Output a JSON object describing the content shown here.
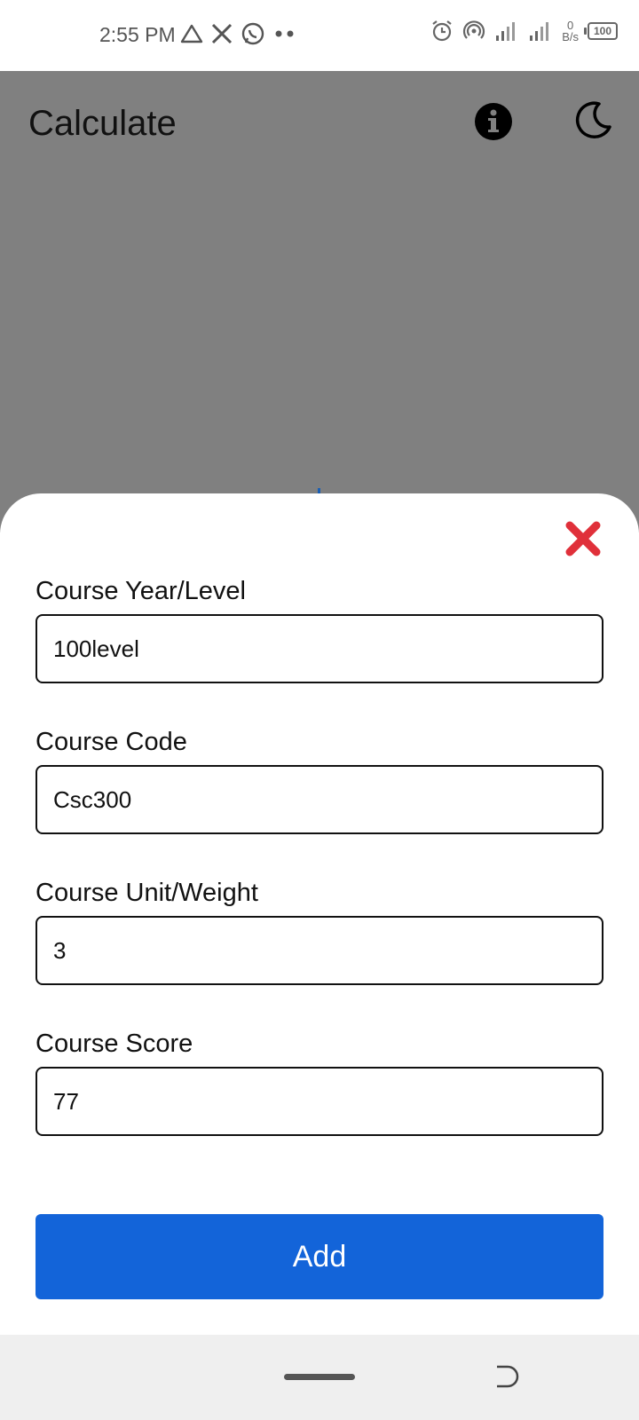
{
  "status_bar": {
    "time": "2:55 PM",
    "left_icons": [
      "drive-icon",
      "x-icon",
      "whatsapp-icon",
      "more-dots-icon"
    ],
    "right_icons": [
      "alarm-icon",
      "hotspot-icon",
      "signal-icon",
      "signal-icon"
    ],
    "net_speed_value": "0",
    "net_speed_unit": "B/s",
    "battery": "100"
  },
  "app": {
    "title": "Calculate",
    "icons": [
      "info-icon",
      "moon-icon"
    ]
  },
  "sheet": {
    "fields": [
      {
        "label": "Course Year/Level",
        "value": "100level"
      },
      {
        "label": "Course Code",
        "value": "Csc300"
      },
      {
        "label": "Course Unit/Weight",
        "value": "3"
      },
      {
        "label": "Course Score",
        "value": "77"
      }
    ],
    "add_label": "Add"
  },
  "colors": {
    "overlay": "#808080",
    "accent": "#1364d9",
    "close": "#e0303a",
    "navbar": "#efefef"
  }
}
